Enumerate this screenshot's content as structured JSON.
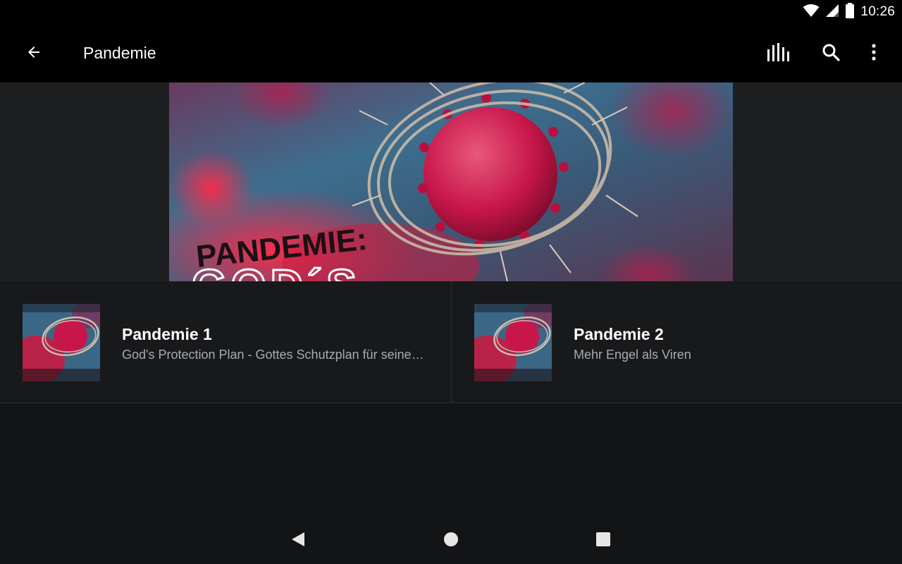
{
  "status_bar": {
    "time": "10:26",
    "icons": [
      "wifi-icon",
      "cellular-signal-icon",
      "battery-icon"
    ]
  },
  "app_bar": {
    "title": "Pandemie",
    "back_icon": "arrow-back-icon",
    "actions": [
      "equalizer-icon",
      "search-icon",
      "more-vert-icon"
    ]
  },
  "banner": {
    "headline": "PANDEMIE:",
    "subline": "GOD´S"
  },
  "episodes": [
    {
      "title": "Pandemie 1",
      "subtitle": "God's Protection Plan - Gottes Schutzplan für seine Kinder"
    },
    {
      "title": "Pandemie 2",
      "subtitle": "Mehr Engel als Viren"
    }
  ],
  "nav_bar": {
    "icons": [
      "nav-back-icon",
      "nav-home-icon",
      "nav-recents-icon"
    ]
  },
  "colors": {
    "app_bar": "#000000",
    "background": "#131416",
    "list_bg": "#18191b",
    "subtitle": "#a9abae",
    "virus": "#c8164a",
    "banner_blue": "#3e6f8f"
  }
}
